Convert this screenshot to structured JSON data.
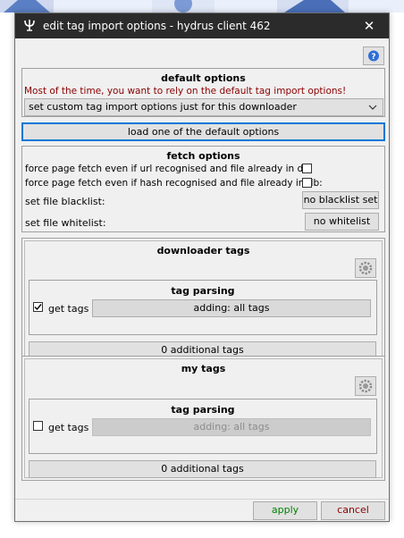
{
  "window": {
    "title": "edit tag import options - hydrus client 462",
    "close_glyph": "✕",
    "title_icon": "psi-icon"
  },
  "help_button": {
    "icon": "help-icon"
  },
  "default_options": {
    "heading": "default options",
    "warning": "Most of the time, you want to rely on the default tag import options!",
    "warning_color": "#8b0000",
    "selected": "set custom tag import options just for this downloader",
    "load_button": "load one of the default options"
  },
  "fetch_options": {
    "heading": "fetch options",
    "url_fetch_label": "force page fetch even if url recognised and file already in db:",
    "hash_fetch_label": "force page fetch even if hash recognised and file already in db:",
    "url_fetch_checked": false,
    "hash_fetch_checked": false,
    "blacklist_label": "set file blacklist:",
    "blacklist_button": "no blacklist set",
    "whitelist_label": "set file whitelist:",
    "whitelist_button": "no whitelist"
  },
  "downloader_tags": {
    "heading": "downloader tags",
    "settings_icon": "gear-icon",
    "parsing_heading": "tag parsing",
    "get_tags_label": "get tags",
    "get_tags_checked": true,
    "adding_button": "adding: all tags",
    "additional_button": "0 additional tags"
  },
  "my_tags": {
    "heading": "my tags",
    "settings_icon": "gear-icon",
    "parsing_heading": "tag parsing",
    "get_tags_label": "get tags",
    "get_tags_checked": false,
    "adding_button": "adding: all tags",
    "additional_button": "0 additional tags"
  },
  "footer": {
    "apply": "apply",
    "cancel": "cancel",
    "apply_color": "#008000",
    "cancel_color": "#8b0000"
  }
}
